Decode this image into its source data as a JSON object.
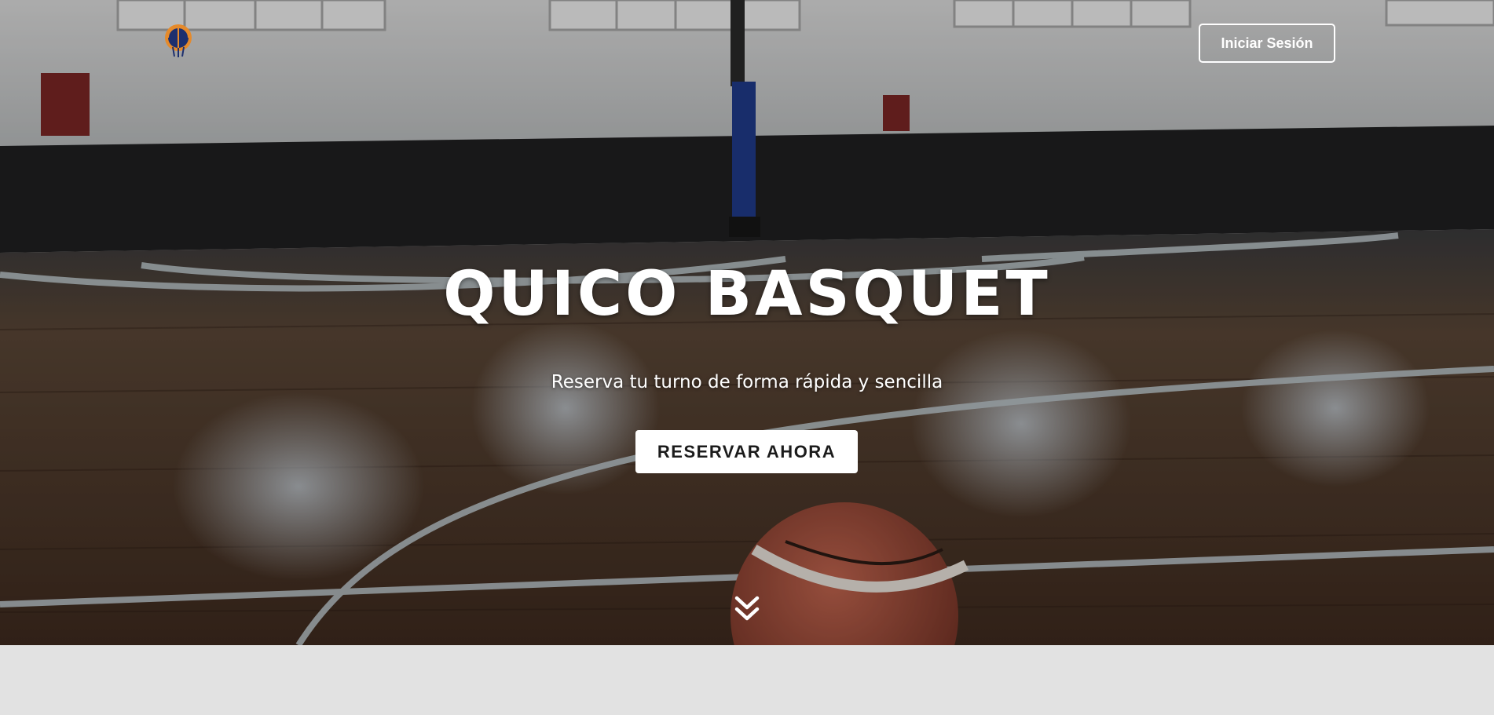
{
  "header": {
    "logo_icon": "quico-basquet-logo",
    "login_label": "Iniciar Sesión"
  },
  "hero": {
    "title": "QUICO BASQUET",
    "subtitle": "Reserva tu turno de forma rápida y sencilla",
    "cta_label": "RESERVAR AHORA",
    "scroll_icon": "double-chevron-down-icon"
  },
  "colors": {
    "button_bg": "#ffffff",
    "button_text": "#1b1b1b",
    "section_bg": "#e2e2e2",
    "wall": "#d6d6d6",
    "wall_band": "#1f1f1f",
    "floor": "#6b4a32"
  }
}
